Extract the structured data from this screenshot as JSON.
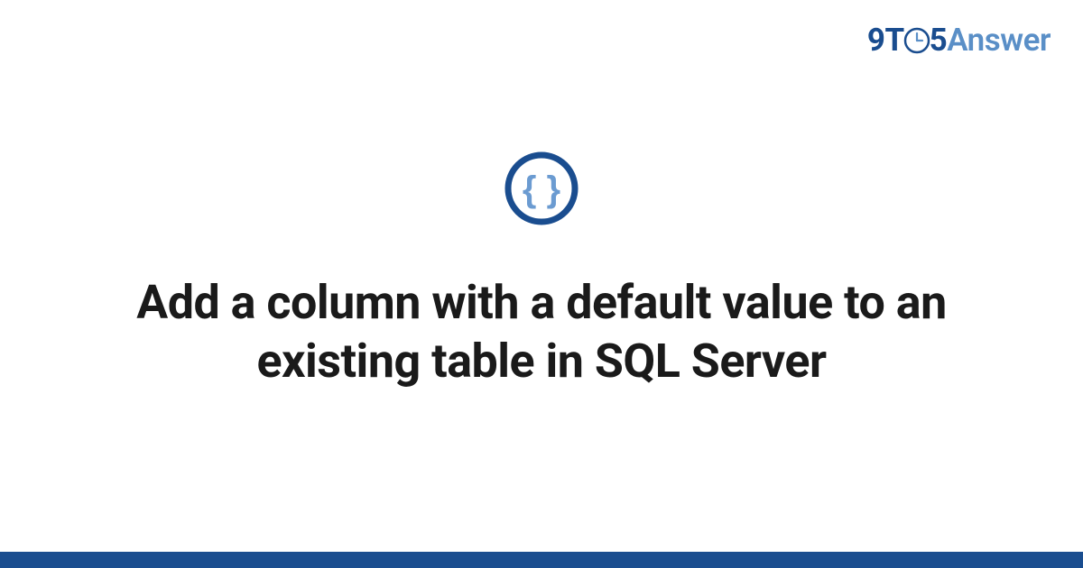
{
  "logo": {
    "part1": "9T",
    "part2": "5",
    "part3": "Answer"
  },
  "icon": {
    "name": "curly-braces"
  },
  "title": "Add a column with a default value to an existing table in SQL Server",
  "colors": {
    "primary": "#1a4d8f",
    "secondary": "#5a8fc7",
    "accent_light": "#6b9bd1"
  }
}
